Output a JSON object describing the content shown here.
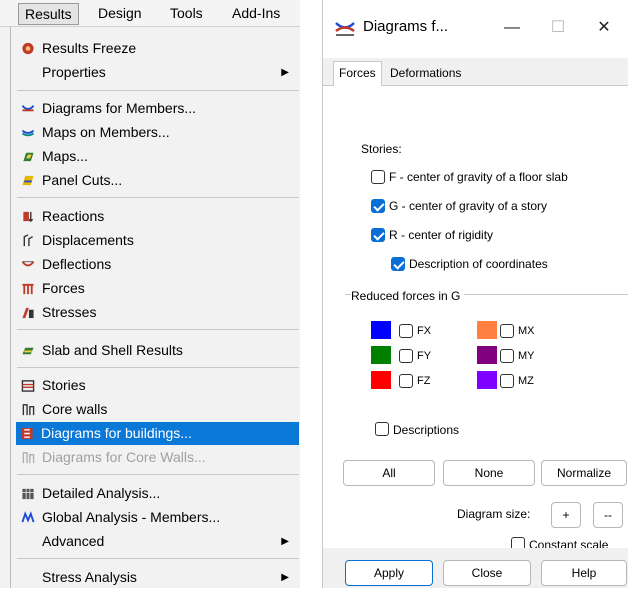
{
  "menubar": {
    "items": [
      {
        "label": "Results"
      },
      {
        "label": "Design"
      },
      {
        "label": "Tools"
      },
      {
        "label": "Add-Ins"
      }
    ]
  },
  "menu": {
    "results_freeze": "Results Freeze",
    "properties": "Properties",
    "diagrams_for_members": "Diagrams for Members...",
    "maps_on_members": "Maps on Members...",
    "maps": "Maps...",
    "panel_cuts": "Panel Cuts...",
    "reactions": "Reactions",
    "displacements": "Displacements",
    "deflections": "Deflections",
    "forces": "Forces",
    "stresses": "Stresses",
    "slab_and_shell_results": "Slab and Shell Results",
    "stories": "Stories",
    "core_walls": "Core walls",
    "diagrams_for_buildings": "Diagrams for buildings...",
    "diagrams_for_core_walls": "Diagrams for Core Walls...",
    "detailed_analysis": "Detailed Analysis...",
    "global_analysis_members": "Global Analysis - Members...",
    "advanced": "Advanced",
    "stress_analysis": "Stress Analysis"
  },
  "dialog": {
    "title": "Diagrams f...",
    "tabs": {
      "forces": "Forces",
      "deformations": "Deformations"
    },
    "stories_label": "Stories:",
    "options": {
      "f": "F - center of gravity of a floor slab",
      "g": "G - center of gravity of a story",
      "r": "R - center of rigidity",
      "description": "Description of coordinates"
    },
    "option_state": {
      "f": false,
      "g": true,
      "r": true,
      "description": true
    },
    "reduced_forces_label": "Reduced forces in G",
    "forces": {
      "fx": {
        "label": "FX",
        "color": "#0000ff"
      },
      "fy": {
        "label": "FY",
        "color": "#008000"
      },
      "fz": {
        "label": "FZ",
        "color": "#ff0000"
      },
      "mx": {
        "label": "MX",
        "color": "#ff8040"
      },
      "my": {
        "label": "MY",
        "color": "#800080"
      },
      "mz": {
        "label": "MZ",
        "color": "#8000ff"
      }
    },
    "descriptions_label": "Descriptions",
    "buttons": {
      "all": "All",
      "none": "None",
      "normalize": "Normalize",
      "plus": "+",
      "minus": "--",
      "apply": "Apply",
      "close": "Close",
      "help": "Help"
    },
    "diagram_size_label": "Diagram size:",
    "constant_scale_label": "Constant scale",
    "constant_scale_checked": false
  },
  "colors": {
    "highlight": "#0a78d7",
    "checkbox_accent": "#0a6fd4"
  }
}
